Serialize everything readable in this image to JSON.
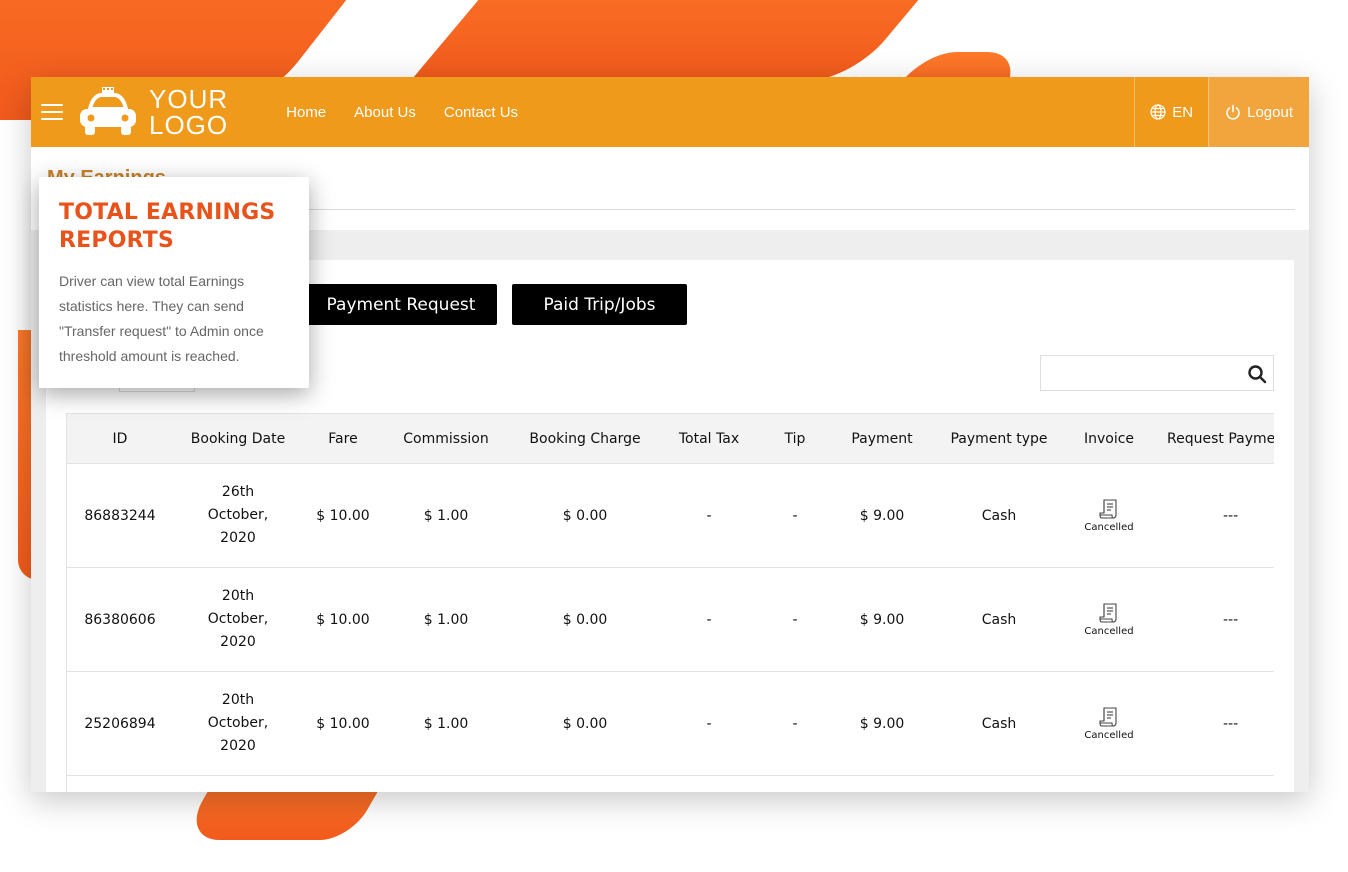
{
  "brand": {
    "logo_line1": "YOUR",
    "logo_line2": "LOGO"
  },
  "nav": {
    "links": [
      "Home",
      "About Us",
      "Contact Us"
    ],
    "language": "EN",
    "logout": "Logout"
  },
  "page": {
    "title": "My Earnings"
  },
  "tooltip": {
    "title": "TOTAL EARNINGS REPORTS",
    "body": "Driver can view total Earnings statistics here. They can send \"Transfer request\" to Admin once threshold amount is reached."
  },
  "actions": {
    "payment_request": "Payment Request",
    "paid_trips": "Paid Trip/Jobs"
  },
  "search": {
    "placeholder": ""
  },
  "table": {
    "columns": [
      "ID",
      "Booking Date",
      "Fare",
      "Commission",
      "Booking Charge",
      "Total Tax",
      "Tip",
      "Payment",
      "Payment type",
      "Invoice",
      "Request Payment"
    ],
    "rows": [
      {
        "id": "86883244",
        "date_l1": "26th",
        "date_l2": "October,",
        "date_l3": "2020",
        "fare": "$ 10.00",
        "commission": "$ 1.00",
        "booking_charge": "$ 0.00",
        "total_tax": "-",
        "tip": "-",
        "payment": "$ 9.00",
        "payment_type": "Cash",
        "invoice_status": "Cancelled",
        "request": "---"
      },
      {
        "id": "86380606",
        "date_l1": "20th",
        "date_l2": "October,",
        "date_l3": "2020",
        "fare": "$ 10.00",
        "commission": "$ 1.00",
        "booking_charge": "$ 0.00",
        "total_tax": "-",
        "tip": "-",
        "payment": "$ 9.00",
        "payment_type": "Cash",
        "invoice_status": "Cancelled",
        "request": "---"
      },
      {
        "id": "25206894",
        "date_l1": "20th",
        "date_l2": "October,",
        "date_l3": "2020",
        "fare": "$ 10.00",
        "commission": "$ 1.00",
        "booking_charge": "$ 0.00",
        "total_tax": "-",
        "tip": "-",
        "payment": "$ 9.00",
        "payment_type": "Cash",
        "invoice_status": "Cancelled",
        "request": "---"
      }
    ]
  },
  "colors": {
    "navbar": "#ef9a1a",
    "accent": "#e8531b",
    "button": "#000000"
  }
}
